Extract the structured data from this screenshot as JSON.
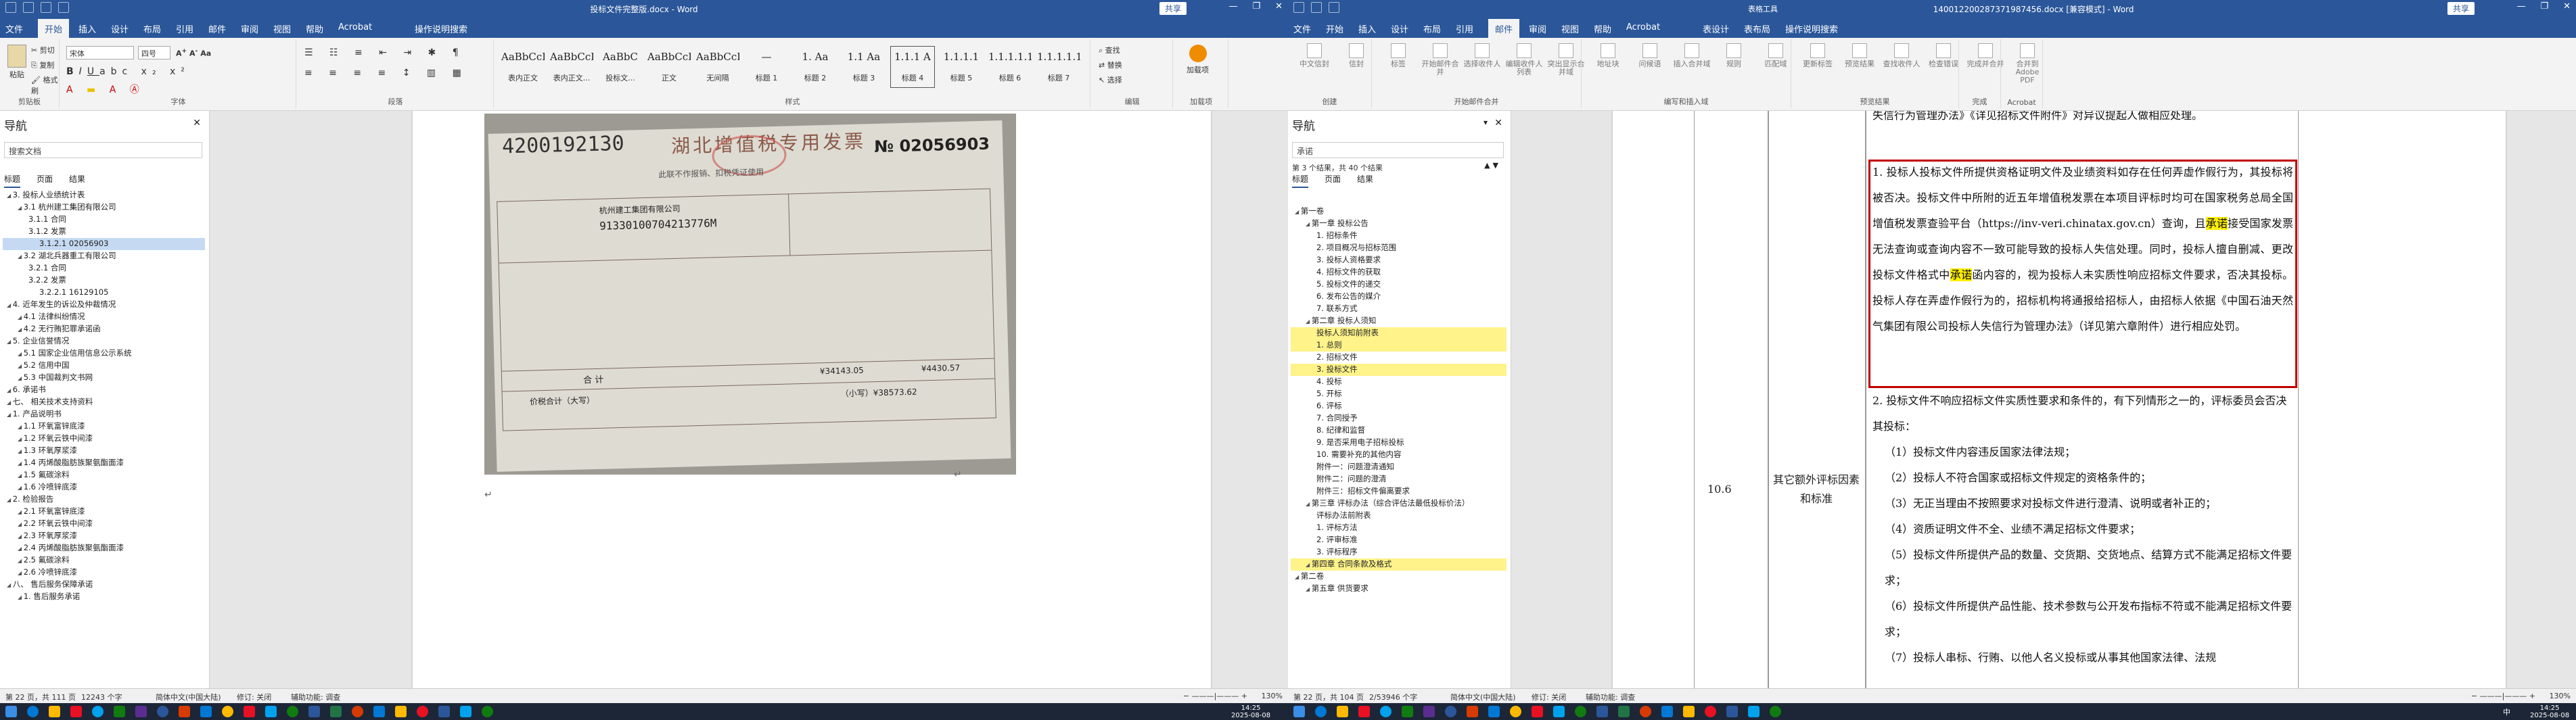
{
  "left_window": {
    "title": "投标文件完整版.docx - Word",
    "tabs": [
      "文件",
      "开始",
      "插入",
      "设计",
      "布局",
      "引用",
      "邮件",
      "审阅",
      "视图",
      "帮助",
      "Acrobat",
      "操作说明搜索"
    ],
    "active_tab": "开始",
    "share_label": "共享",
    "ribbon": {
      "font_name": "宋体",
      "font_size": "四号",
      "clipboard_label": "剪贴板",
      "font_label": "字体",
      "paragraph_label": "段落",
      "styles_label": "样式",
      "editing_label": "编辑",
      "addins_label": "加载项",
      "paste_label": "粘贴",
      "cut_label": "剪切",
      "copy_label": "复制",
      "painter_label": "格式刷",
      "find_label": "查找",
      "replace_label": "替换",
      "select_label": "选择",
      "addin_btn": "加载项",
      "styles": [
        {
          "preview": "AaBbCcDd",
          "name": "表内正文"
        },
        {
          "preview": "AaBbCcDd",
          "name": "表内正文..."
        },
        {
          "preview": "AaBbC",
          "name": "投标文..."
        },
        {
          "preview": "AaBbCcDd",
          "name": "正文"
        },
        {
          "preview": "AaBbCcDd",
          "name": "无间隔"
        },
        {
          "preview": "—",
          "name": "标题 1"
        },
        {
          "preview": "1. Aa",
          "name": "标题 2"
        },
        {
          "preview": "1.1 Aa",
          "name": "标题 3"
        },
        {
          "preview": "1.1.1 A",
          "name": "标题 4"
        },
        {
          "preview": "1.1.1.1",
          "name": "标题 5"
        },
        {
          "preview": "1.1.1.1.1",
          "name": "标题 6"
        },
        {
          "preview": "1.1.1.1.1.1",
          "name": "标题 7"
        }
      ],
      "selected_style": "标题 4"
    },
    "nav": {
      "title": "导航",
      "search_placeholder": "搜索文档",
      "tabs": [
        "标题",
        "页面",
        "结果"
      ],
      "items": [
        {
          "text": "3. 投标人业绩统计表",
          "level": 0
        },
        {
          "text": "3.1 杭州建工集团有限公司",
          "level": 1
        },
        {
          "text": "3.1.1 合同",
          "level": 2
        },
        {
          "text": "3.1.2 发票",
          "level": 2
        },
        {
          "text": "3.1.2.1 02056903",
          "level": 3,
          "selected": true
        },
        {
          "text": "3.2 湖北兵器重工有限公司",
          "level": 1
        },
        {
          "text": "3.2.1 合同",
          "level": 2
        },
        {
          "text": "3.2.2 发票",
          "level": 2
        },
        {
          "text": "3.2.2.1 16129105",
          "level": 3
        },
        {
          "text": "4. 近年发生的诉讼及仲裁情况",
          "level": 0
        },
        {
          "text": "4.1 法律纠纷情况",
          "level": 1
        },
        {
          "text": "4.2 无行贿犯罪承诺函",
          "level": 1
        },
        {
          "text": "5. 企业信誉情况",
          "level": 0
        },
        {
          "text": "5.1 国家企业信用信息公示系统",
          "level": 1
        },
        {
          "text": "5.2 信用中国",
          "level": 1
        },
        {
          "text": "5.3 中国裁判文书网",
          "level": 1
        },
        {
          "text": "6. 承诺书",
          "level": 0
        },
        {
          "text": "七、 相关技术支持资料",
          "level": 0
        },
        {
          "text": "1. 产品说明书",
          "level": 0
        },
        {
          "text": "1.1 环氧富锌底漆",
          "level": 1
        },
        {
          "text": "1.2 环氧云铁中间漆",
          "level": 1
        },
        {
          "text": "1.3 环氧厚浆漆",
          "level": 1
        },
        {
          "text": "1.4 丙烯酸脂肪族聚氨酯面漆",
          "level": 1
        },
        {
          "text": "1.5 氟碳涂料",
          "level": 1
        },
        {
          "text": "1.6 冷喷锌底漆",
          "level": 1
        },
        {
          "text": "2. 检验报告",
          "level": 0
        },
        {
          "text": "2.1 环氧富锌底漆",
          "level": 1
        },
        {
          "text": "2.2 环氧云铁中间漆",
          "level": 1
        },
        {
          "text": "2.3 环氧厚浆漆",
          "level": 1
        },
        {
          "text": "2.4 丙烯酸脂肪族聚氨酯面漆",
          "level": 1
        },
        {
          "text": "2.5 氟碳涂料",
          "level": 1
        },
        {
          "text": "2.6 冷喷锌底漆",
          "level": 1
        },
        {
          "text": "八、 售后服务保障承诺",
          "level": 0
        },
        {
          "text": "1. 售后服务承诺",
          "level": 1
        }
      ]
    },
    "invoice": {
      "number_left": "4200192130",
      "title": "湖北增值税专用发票",
      "number_right": "№ 02056903",
      "subtitle": "此联不作报销、扣税凭证使用",
      "buyer_name": "杭州建工集团有限公司",
      "tax_id": "91330100704213776M",
      "total_label": "合  计",
      "amount": "¥34143.05",
      "tax_amount": "¥4430.57",
      "total_words_label": "价税合计（大写）",
      "total_small": "（小写）¥38573.62"
    },
    "status": {
      "page": "第 22 页，共 111 页",
      "words": "12243 个字",
      "lang": "简体中文(中国大陆)",
      "track": "修订: 关闭",
      "access": "辅助功能: 调查",
      "zoom": "130%"
    }
  },
  "right_window": {
    "title": "140012200287371987456.docx [兼容模式] - Word",
    "context_tool": "表格工具",
    "tabs": [
      "文件",
      "开始",
      "插入",
      "设计",
      "布局",
      "引用",
      "邮件",
      "审阅",
      "视图",
      "帮助",
      "Acrobat",
      "表设计",
      "表布局",
      "操作说明搜索"
    ],
    "active_tab": "邮件",
    "share_label": "共享",
    "ribbon_groups": [
      "创建",
      "开始邮件合并",
      "编写和插入域",
      "预览结果",
      "完成",
      "Acrobat"
    ],
    "ribbon_buttons": [
      "中文信封",
      "信封",
      "标签",
      "开始邮件合并",
      "选择收件人",
      "编辑收件人列表",
      "突出显示合并域",
      "地址块",
      "问候语",
      "插入合并域",
      "规则",
      "匹配域",
      "更新标签",
      "预览结果",
      "查找收件人",
      "检查错误",
      "完成并合并",
      "合并到Adobe PDF"
    ],
    "nav": {
      "title": "导航",
      "search_value": "承诺",
      "result_count": "第 3 个结果，共 40 个结果",
      "tabs": [
        "标题",
        "页面",
        "结果"
      ],
      "items": [
        {
          "text": "第一卷",
          "level": 0
        },
        {
          "text": "第一章 投标公告",
          "level": 1
        },
        {
          "text": "1. 招标条件",
          "level": 2
        },
        {
          "text": "2. 项目概况与招标范围",
          "level": 2
        },
        {
          "text": "3. 投标人资格要求",
          "level": 2
        },
        {
          "text": "4. 招标文件的获取",
          "level": 2
        },
        {
          "text": "5. 投标文件的递交",
          "level": 2
        },
        {
          "text": "6. 发布公告的媒介",
          "level": 2
        },
        {
          "text": "7. 联系方式",
          "level": 2
        },
        {
          "text": "第二章 投标人须知",
          "level": 1
        },
        {
          "text": "投标人须知前附表",
          "level": 2,
          "hl": true
        },
        {
          "text": "1. 总则",
          "level": 2,
          "hl": true
        },
        {
          "text": "2. 招标文件",
          "level": 2
        },
        {
          "text": "3. 投标文件",
          "level": 2,
          "hl": true
        },
        {
          "text": "4. 投标",
          "level": 2
        },
        {
          "text": "5. 开标",
          "level": 2
        },
        {
          "text": "6. 评标",
          "level": 2
        },
        {
          "text": "7. 合同授予",
          "level": 2
        },
        {
          "text": "8. 纪律和监督",
          "level": 2
        },
        {
          "text": "9. 是否采用电子招标投标",
          "level": 2
        },
        {
          "text": "10. 需要补充的其他内容",
          "level": 2
        },
        {
          "text": "附件一：问题澄清通知",
          "level": 2
        },
        {
          "text": "附件二：问题的澄清",
          "level": 2
        },
        {
          "text": "附件三：招标文件偏离要求",
          "level": 2
        },
        {
          "text": "第三章 评标办法（综合评估法最低投标价法）",
          "level": 1
        },
        {
          "text": "评标办法前附表",
          "level": 2
        },
        {
          "text": "1. 评标方法",
          "level": 2
        },
        {
          "text": "2. 评审标准",
          "level": 2
        },
        {
          "text": "3. 评标程序",
          "level": 2
        },
        {
          "text": "第四章 合同条款及格式",
          "level": 1,
          "hl": true
        },
        {
          "text": "第二卷",
          "level": 0
        },
        {
          "text": "第五章 供货要求",
          "level": 1
        }
      ]
    },
    "table": {
      "row_no": "10.6",
      "row_title": "其它额外评标因素和标准",
      "top_fragment": "失信行为管理办法》《详见招标文件附件》对异议提起人做相应处理。",
      "boxed_paragraph": [
        {
          "t": "1. 投标人投标文件所提供资格证明文件及业绩资料如存在任何弄虚作",
          "m": false
        },
        {
          "t": "假行为，其投标将被否决。投标文件中所附的近五年增值税发票在本",
          "m": false
        },
        {
          "t": "项目评标时均可在国家税务总局全国增值税发票查验平台",
          "m": false
        },
        {
          "t": "（https://inv-veri.chinatax.gov.cn）查询，且",
          "m": false
        },
        {
          "t": "承诺",
          "m": true
        },
        {
          "t": "接受国家发票无法查询或查询内容不一致可能导致的投标人失信处理。同时，投标人",
          "m": false
        },
        {
          "t": "擅自删减、更改投标文件格式中",
          "m": false
        },
        {
          "t": "承诺",
          "m": true
        },
        {
          "t": "函内容的，视为投标人未实质性响应招标文件要求，否决其投标。投标人存在弄虚作假行为的，招标机构将通报给招标人，由招标人依据《中国石油天然气集团有限公司投标人失信行为管理办法》（详见第六章附件）进行相应处罚。",
          "m": false
        }
      ],
      "items": [
        "2. 投标文件不响应招标文件实质性要求和条件的，有下列情形之一的，评标委员会否决其投标：",
        "（1）投标文件内容违反国家法律法规；",
        "（2）投标人不符合国家或招标文件规定的资格条件的；",
        "（3）无正当理由不按照要求对投标文件进行澄清、说明或者补正的；",
        "（4）资质证明文件不全、业绩不满足招标文件要求；",
        "（5）投标文件所提供产品的数量、交货期、交货地点、结算方式不能满足招标文件要求；",
        "（6）投标文件所提供产品性能、技术参数与公开发布指标不符或不能满足招标文件要求；",
        "（7）投标人串标、行贿、以他人名义投标或从事其他国家法律、法规"
      ]
    },
    "status": {
      "page": "第 22 页，共 104 页",
      "words": "2/53946 个字",
      "lang": "简体中文(中国大陆)",
      "track": "修订: 关闭",
      "access": "辅助功能: 调查",
      "zoom": "130%"
    }
  },
  "taskbar": {
    "time1": "14:25",
    "date1": "2025-08-08",
    "time2": "14:25",
    "date2": "2025-08-08",
    "lang": "中"
  }
}
